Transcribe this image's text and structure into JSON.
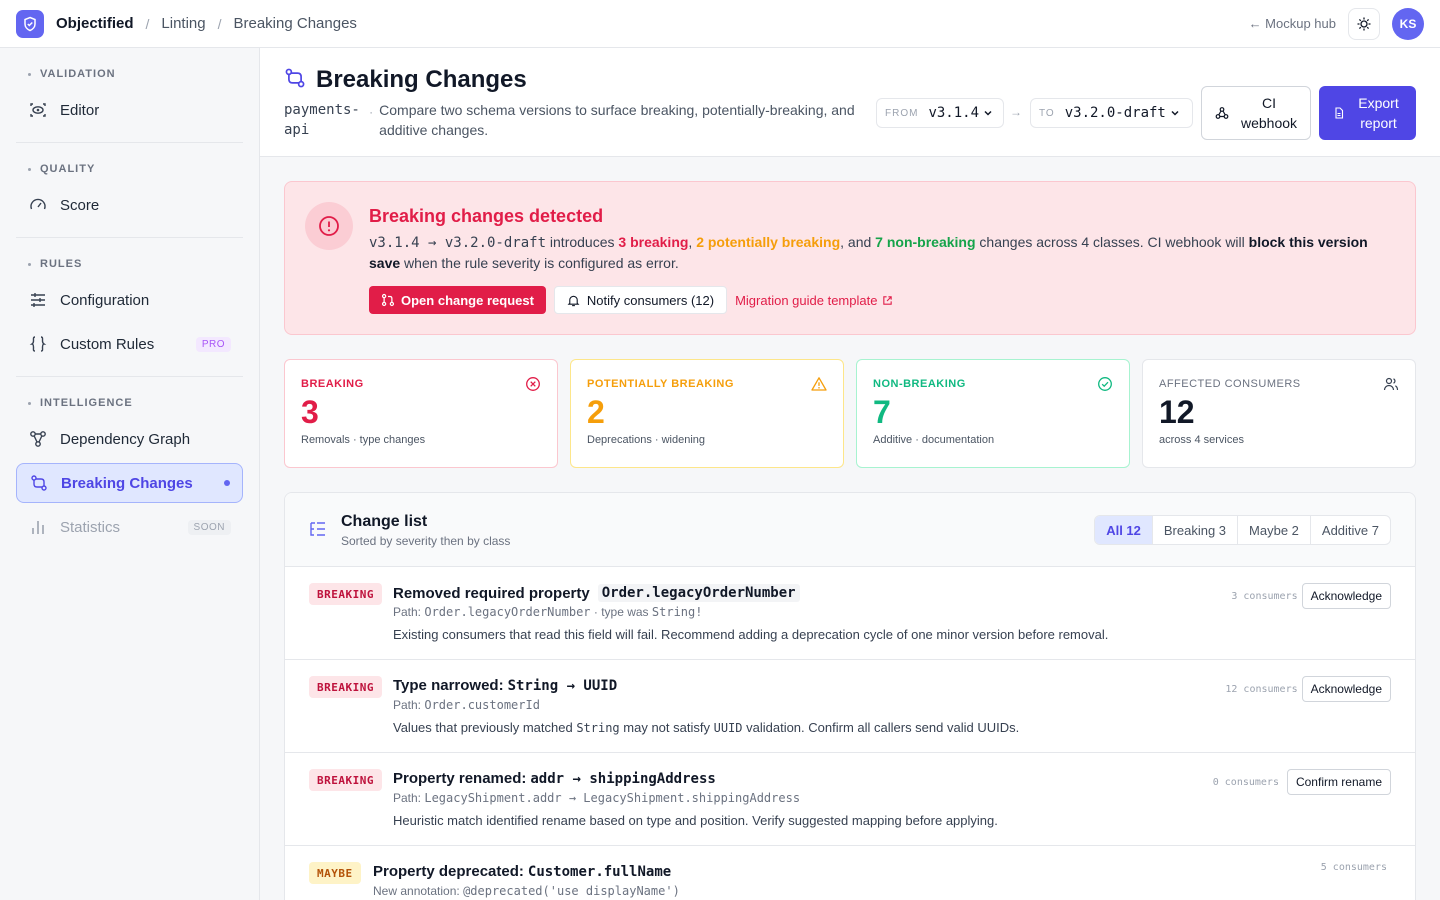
{
  "topbar": {
    "brand": "Objectified",
    "crumbs": [
      "Linting",
      "Breaking Changes"
    ],
    "hub_link": "← Mockup hub",
    "avatar": "KS"
  },
  "sidebar": {
    "sections": [
      {
        "heading": "VALIDATION",
        "items": [
          {
            "label": "Editor",
            "icon": "eye-scan-icon"
          }
        ]
      },
      {
        "heading": "QUALITY",
        "items": [
          {
            "label": "Score",
            "icon": "gauge-icon"
          }
        ]
      },
      {
        "heading": "RULES",
        "items": [
          {
            "label": "Configuration",
            "icon": "sliders-icon"
          },
          {
            "label": "Custom Rules",
            "icon": "braces-icon",
            "pill": "PRO"
          }
        ]
      },
      {
        "heading": "INTELLIGENCE",
        "items": [
          {
            "label": "Dependency Graph",
            "icon": "graph-icon"
          },
          {
            "label": "Breaking Changes",
            "icon": "git-compare-icon",
            "active": true
          },
          {
            "label": "Statistics",
            "icon": "bar-chart-icon",
            "pill": "SOON",
            "disabled": true
          }
        ]
      }
    ]
  },
  "header": {
    "title": "Breaking Changes",
    "api_name": "payments-api",
    "separator": "·",
    "description": "Compare two schema versions to surface breaking, potentially-breaking, and additive changes.",
    "from_label": "FROM",
    "from_value": "v3.1.4",
    "to_label": "TO",
    "to_value": "v3.2.0-draft",
    "arrow": "→",
    "ci_button": "CI webhook",
    "export_button": "Export report"
  },
  "alert": {
    "title": "Breaking changes detected",
    "versions": "v3.1.4 → v3.2.0-draft",
    "t1": " introduces ",
    "breaking": "3 breaking",
    "t2": ", ",
    "potential": "2 potentially breaking",
    "t3": ", and ",
    "nonbreaking": "7 non-breaking",
    "t4": " changes across 4 classes. CI webhook will ",
    "block": "block this version save",
    "t5": " when the rule severity is configured as error.",
    "btn_primary": "Open change request",
    "btn_secondary": "Notify consumers (12)",
    "link": "Migration guide template"
  },
  "stats": [
    {
      "label": "BREAKING",
      "value": "3",
      "sub": "Removals · type changes",
      "color": "#e11d48",
      "border": "#fbc7cf",
      "icon": "x-circle-icon"
    },
    {
      "label": "POTENTIALLY BREAKING",
      "value": "2",
      "sub": "Deprecations · widening",
      "color": "#f59e0b",
      "border": "#fde68a",
      "icon": "warning-icon"
    },
    {
      "label": "NON-BREAKING",
      "value": "7",
      "sub": "Additive · documentation",
      "color": "#10b981",
      "border": "#a7f3d0",
      "icon": "check-circle-icon"
    },
    {
      "label": "AFFECTED CONSUMERS",
      "value": "12",
      "sub": "across 4 services",
      "color": "#111827",
      "border": "#e5e7eb",
      "icon": "users-icon"
    }
  ],
  "change_list": {
    "title": "Change list",
    "subtitle": "Sorted by severity then by class",
    "filters": [
      "All 12",
      "Breaking 3",
      "Maybe 2",
      "Additive 7"
    ],
    "rows": [
      {
        "badge": "BREAKING",
        "title_text": "Removed required property",
        "title_code": "Order.legacyOrderNumber",
        "path_prefix": "Path: ",
        "path_code": "Order.legacyOrderNumber",
        "path_mid": " · type was ",
        "path_code2": "String!",
        "desc": "Existing consumers that read this field will fail. Recommend adding a deprecation cycle of one minor version before removal.",
        "consumers": "3 consumers",
        "action": "Acknowledge"
      },
      {
        "badge": "BREAKING",
        "title_text": "Type narrowed:",
        "title_code": "String → UUID",
        "path_prefix": "Path: ",
        "path_code": "Order.customerId",
        "desc_a": "Values that previously matched ",
        "desc_code1": "String",
        "desc_b": " may not satisfy ",
        "desc_code2": "UUID",
        "desc_c": " validation. Confirm all callers send valid UUIDs.",
        "consumers": "12 consumers",
        "action": "Acknowledge"
      },
      {
        "badge": "BREAKING",
        "title_text": "Property renamed:",
        "title_code": "addr → shippingAddress",
        "path_prefix": "Path: ",
        "path_code": "LegacyShipment.addr → LegacyShipment.shippingAddress",
        "desc": "Heuristic match identified rename based on type and position. Verify suggested mapping before applying.",
        "consumers": "0 consumers",
        "action": "Confirm rename"
      },
      {
        "badge": "MAYBE",
        "title_text": "Property deprecated:",
        "title_code": "Customer.fullName",
        "path_prefix": "New annotation: ",
        "path_code": "@deprecated('use displayName')",
        "consumers": "5 consumers"
      }
    ]
  }
}
